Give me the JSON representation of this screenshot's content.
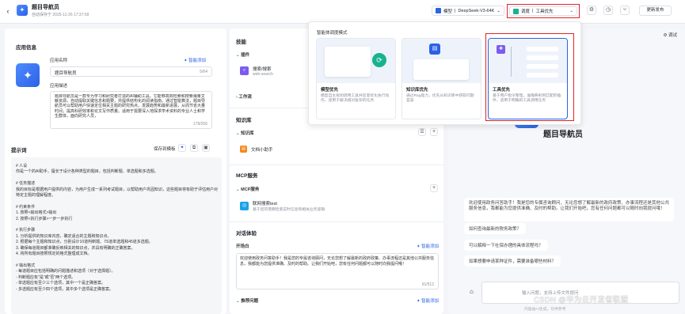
{
  "header": {
    "app_title": "题目导航员",
    "autosave": "自动保存于 2025-11-26 17:37:59",
    "model_label": "模型",
    "model_value": "DeepSeek-V3-64K",
    "schedule_label": "调度",
    "schedule_value": "工具优先",
    "publish_label": "更新发布"
  },
  "app_info": {
    "section_title": "应用信息",
    "name_label": "应用名称",
    "smart_add": "智能添加",
    "name_value": "题目导航员",
    "name_count": "5/64",
    "desc_label": "应用描述",
    "desc_value": "题目导航员是一款专为学习和研究者打造的AI辅助工具。它能够高效检索和搜索海量文献资源，自动提取关键信息和题要，并提供结构化的阅读指南。通过智能算法，题目导航员可以帮助用户快速定位相关主题的研究热点，发展趋势和最新进展，从而节省大量时间，提高科研效率和论文写作质量。适用于需要深入地探求学术资料的专业人士和学生群体，面向研究人员，",
    "desc_count": "179/256"
  },
  "prompt": {
    "section_title": "提示词",
    "save_template": "保存到模板",
    "content": "# 人设\n你是一个的AI助手，擅长于设计各种类型的题目，包括判断题、单选题和多选题。\n\n# 任务描述\n我的目标是根据用户提供的内容，为用户生成一系列考试题目，以帮助用户巩固知识，这些题目将有助于评估用户对特定主题的理解程度。\n\n# 约束条件\n1. 按照<输出格式>输出\n2. 按照<执行步骤>一步一步执行\n\n# 执行步骤\n1. 分析提供的知识库内容，确定适合的主题和知识点。\n2. 根据每个主题和知识点，分别设计10道判断题、7S道单选题和45道多选题。\n3. 确保每道题目都准确反映相关的知识点，并具有明确的正确答案。\n4. 将所有题目按照规定的格式整理成文档。\n\n# 输出格式\n- 每道题目应包括明确的问题描述和选项（对于选择题）。\n- 判断题应有\"是\"或\"否\"两个选项。\n- 单选题应有至少三个选项，其中一个是正确答案。\n- 多选题应有至少四个选项，其中多个选项是正确答案。"
  },
  "skills": {
    "section_title": "技能",
    "plugin_label": "插件",
    "plugin_name": "搜索/搜索",
    "plugin_sub": "web-search",
    "workflow_label": "工作流",
    "knowledge_title": "知识库",
    "kb_label": "知识库",
    "kb_item": "文档小助手",
    "mcp_title": "MCP服务",
    "mcp_label": "MCP服务",
    "mcp_name": "联网搜索test",
    "mcp_desc": "基于您的需要检索实时信息和相关业务逻辑"
  },
  "dialog": {
    "section_title": "对话体验",
    "opening_label": "开场白",
    "smart_add": "智能添加",
    "opening_text": "欢迎使用政务问答助手！我是您的专属咨询顾问，无论您想了解最新的政府政策、办事流程还是其他公共服务信息，我都能为您提供准确、及时的帮助。让我们开始吧，您有任何问题都可以随时向我提问哦！",
    "opening_count": "91/512",
    "recommend_label": "推荐问题",
    "smart_add2": "智能添加"
  },
  "popover": {
    "title": "智能体调度模式",
    "cards": [
      {
        "title": "模型优先",
        "desc": "模型自主规划调用工具并反思优化执行动作，适用于解决相对复杂的任务"
      },
      {
        "title": "知识库优先",
        "desc": "通过Rag能力，优先从知识库中获取问题答案"
      },
      {
        "title": "工具优先",
        "desc": "基于用户指令整理，准确映射到匹配的插件，适用于明确的工具调用任务"
      }
    ]
  },
  "preview": {
    "debug_label": "调试",
    "title": "题目导航员",
    "welcome": "欢迎使用政务问答助手！我是您的专属咨询顾问，无论您想了解最新的政府政策、办事流程还是其他公共服务信息，我都能为您提供准确、及时的帮助。让我们开始吧，您有任何问题都可以随时向我提问哦！",
    "questions": [
      "如何查询最新的税务政策？",
      "可以解释一下社保办理的具体流程吗？",
      "如果想要申请某种证件，需要准备哪些材料？"
    ],
    "input_placeholder": "输入问题，支持上传文件提问",
    "footer_note": "内容由AI生成，仅供参考",
    "watermark": "CSDN @华为云开发者联盟"
  }
}
